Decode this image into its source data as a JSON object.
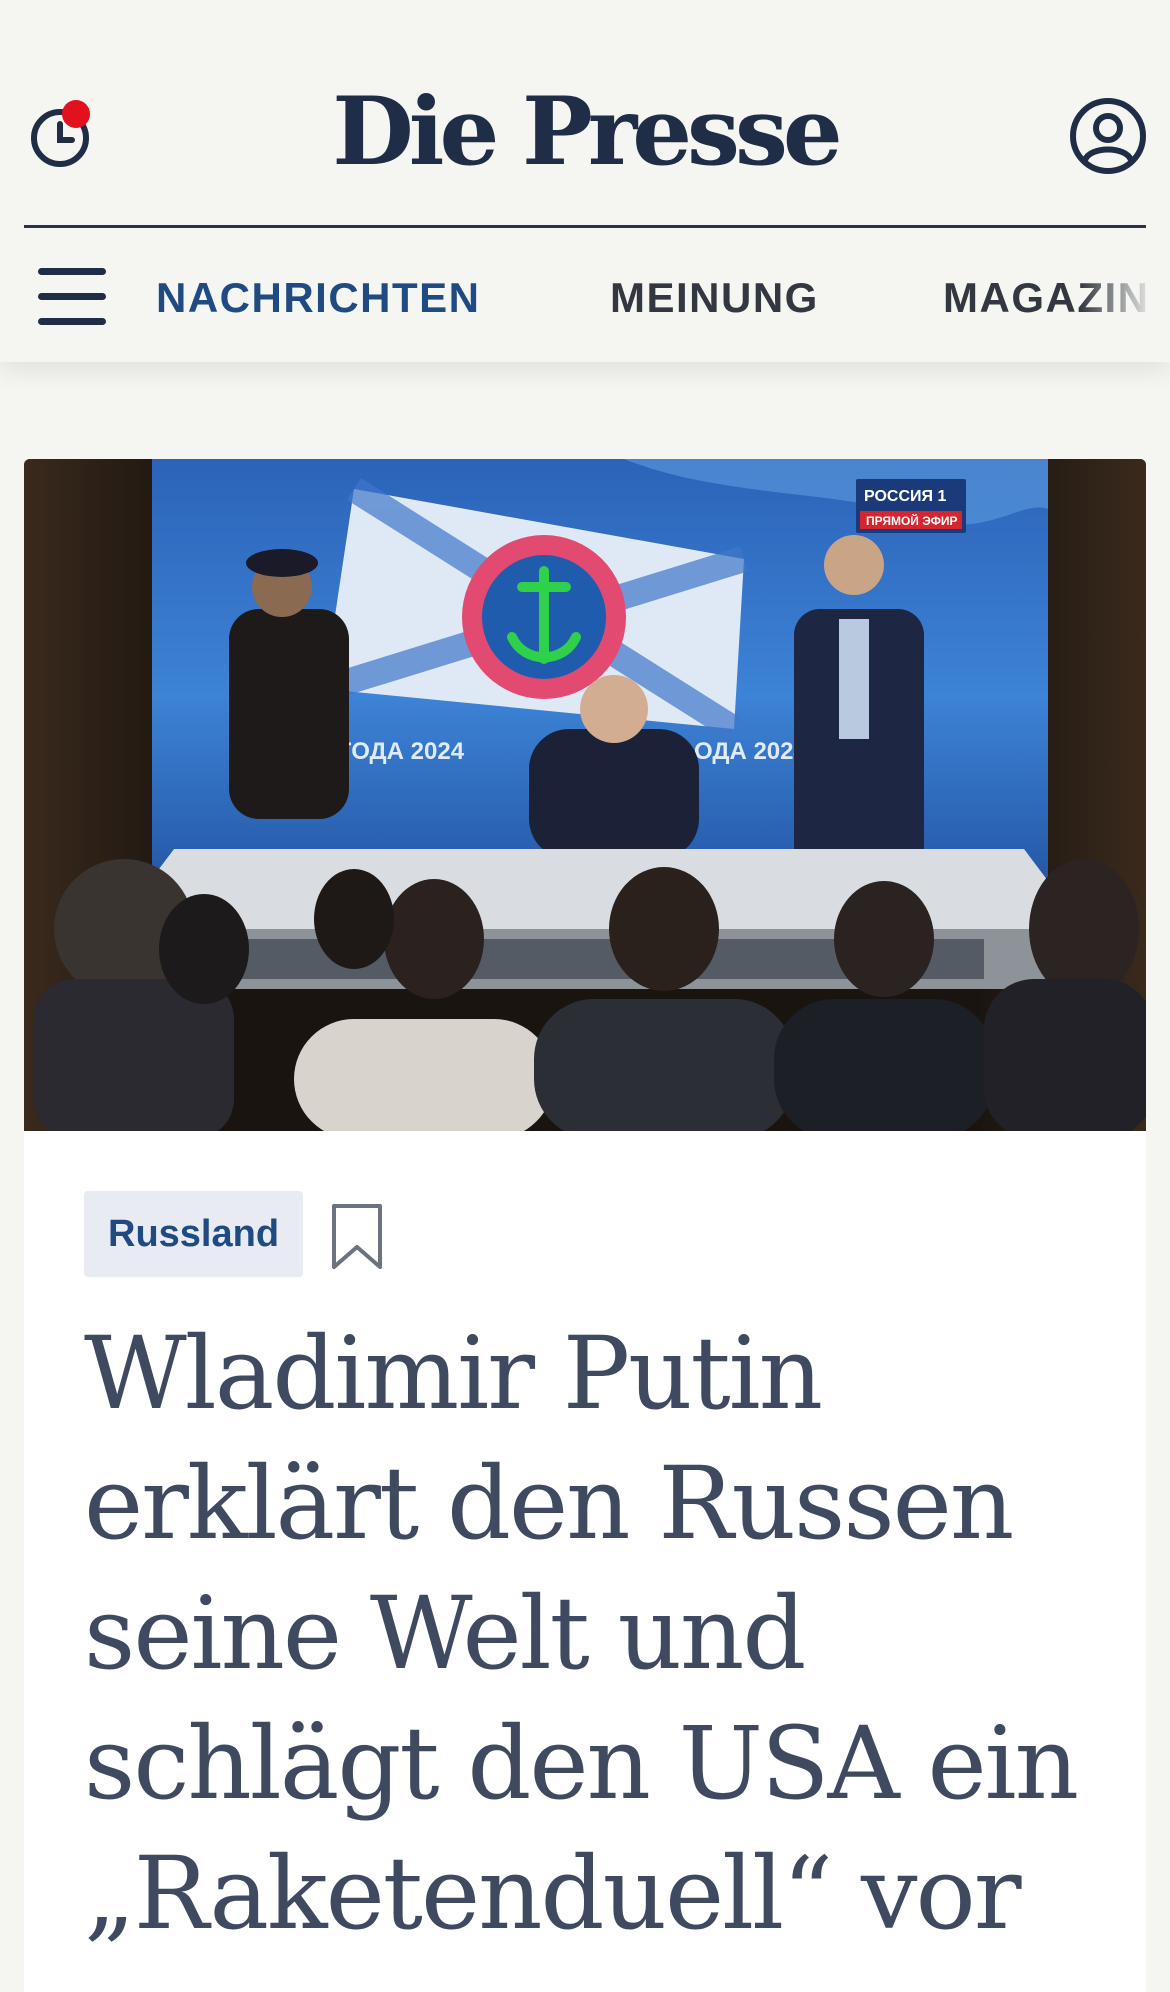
{
  "header": {
    "logo": "Die Presse",
    "recent_icon": "clock-icon",
    "notification_dot_color": "#e3101e",
    "account_icon": "user-account-icon"
  },
  "nav": {
    "menu_icon": "hamburger-menu-icon",
    "items": [
      {
        "label": "NACHRICHTEN",
        "active": true
      },
      {
        "label": "MEINUNG",
        "active": false
      },
      {
        "label": "MAGAZIN",
        "active": false
      }
    ]
  },
  "hero": {
    "alt": "Putin at televised year-end press conference displayed on screen, audience watching",
    "broadcaster_badge": "РОССИЯ 1",
    "live_badge": "ПРЯМОЙ ЭФИР",
    "banner_text_left": "И ГОДА 2024",
    "banner_text_right": "ОДА 2024"
  },
  "article": {
    "category": "Russland",
    "bookmark_icon": "bookmark-icon",
    "headline": "Wladimir Putin erklärt den Russen seine Welt und schlägt den USA ein „Raketenduell“ vor"
  },
  "colors": {
    "brand_navy": "#1f2d47",
    "active_nav": "#1f4a82",
    "headline": "#3f4a60",
    "background": "#f5f5f2"
  }
}
